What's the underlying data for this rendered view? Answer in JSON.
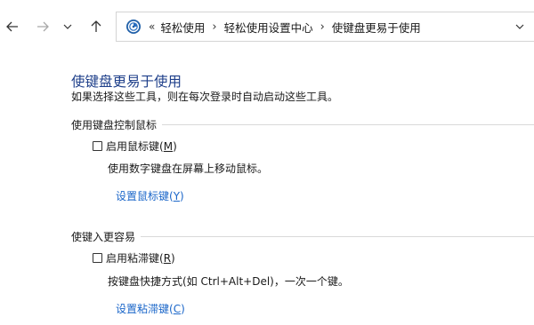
{
  "nav": {
    "back_icon": "arrow-left-icon",
    "forward_icon": "arrow-right-icon",
    "recent_icon": "chevron-down-icon",
    "up_icon": "arrow-up-icon"
  },
  "address": {
    "overflow": "«",
    "breadcrumbs": [
      "轻松使用",
      "轻松使用设置中心",
      "使键盘更易于使用"
    ],
    "separator": "›",
    "dropdown_icon": "chevron-down-icon"
  },
  "page": {
    "title": "使键盘更易于使用",
    "description": "如果选择这些工具，则在每次登录时自动启动这些工具。"
  },
  "sections": [
    {
      "header": "使用键盘控制鼠标",
      "checkbox_label": "启用鼠标键",
      "checkbox_key": "M",
      "checked": false,
      "description": "使用数字键盘在屏幕上移动鼠标。",
      "link_label": "设置鼠标键",
      "link_key": "Y"
    },
    {
      "header": "使键入更容易",
      "checkbox_label": "启用粘滞键",
      "checkbox_key": "R",
      "checked": false,
      "description": "按键盘快捷方式(如 Ctrl+Alt+Del)，一次一个键。",
      "link_label": "设置粘滞键",
      "link_key": "C"
    }
  ],
  "colors": {
    "title": "#1e3f8a",
    "link": "#1a66c9"
  }
}
